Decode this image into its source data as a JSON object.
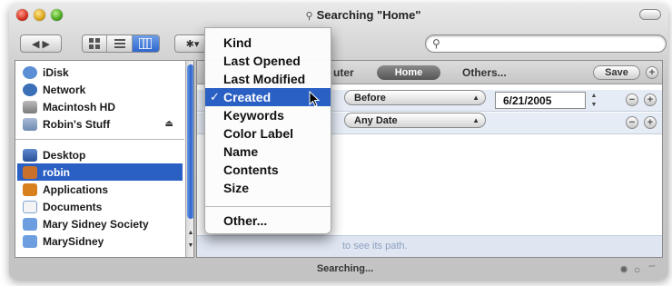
{
  "window": {
    "title": "Searching \"Home\"",
    "status": "Searching..."
  },
  "toolbar": {
    "back_forward": "◀ ▶",
    "action_glyph": "✱▾",
    "search": {
      "value": "",
      "placeholder": ""
    }
  },
  "sidebar": {
    "items": [
      {
        "label": "iDisk",
        "icon": "idisk-icon",
        "color": "#5a8fd6"
      },
      {
        "label": "Network",
        "icon": "network-icon",
        "color": "#3b6fb8"
      },
      {
        "label": "Macintosh HD",
        "icon": "hard-drive-icon",
        "color": "#8d8d8d"
      },
      {
        "label": "Robin's Stuff",
        "icon": "drive-icon",
        "color": "#6f8bb0"
      },
      {
        "label": "Desktop",
        "icon": "desktop-icon",
        "color": "#3a64b0"
      },
      {
        "label": "robin",
        "icon": "home-icon",
        "color": "#c9712b",
        "selected": true
      },
      {
        "label": "Applications",
        "icon": "applications-icon",
        "color": "#d8801e"
      },
      {
        "label": "Documents",
        "icon": "documents-icon",
        "color": "#7fa3cf"
      },
      {
        "label": "Mary Sidney Society",
        "icon": "folder-icon",
        "color": "#6d9fe0"
      },
      {
        "label": "MarySidney",
        "icon": "folder-icon",
        "color": "#6d9fe0"
      }
    ]
  },
  "search_bar": {
    "scope_partial": "uter",
    "scope_selected": "Home",
    "scope_others": "Others...",
    "save_label": "Save"
  },
  "criteria": [
    {
      "operator": "Before",
      "date": "6/21/2005"
    },
    {
      "operator": "Any Date"
    }
  ],
  "hint_text": "to see its path.",
  "menu": {
    "items": [
      {
        "label": "Kind"
      },
      {
        "label": "Last Opened"
      },
      {
        "label": "Last Modified"
      },
      {
        "label": "Created",
        "checked": true
      },
      {
        "label": "Keywords"
      },
      {
        "label": "Color Label"
      },
      {
        "label": "Name"
      },
      {
        "label": "Contents"
      },
      {
        "label": "Size"
      }
    ],
    "other": "Other...",
    "check_glyph": "✓"
  },
  "colors": {
    "selection": "#2a5fc4",
    "criteria_row": "#e6ecf6"
  }
}
